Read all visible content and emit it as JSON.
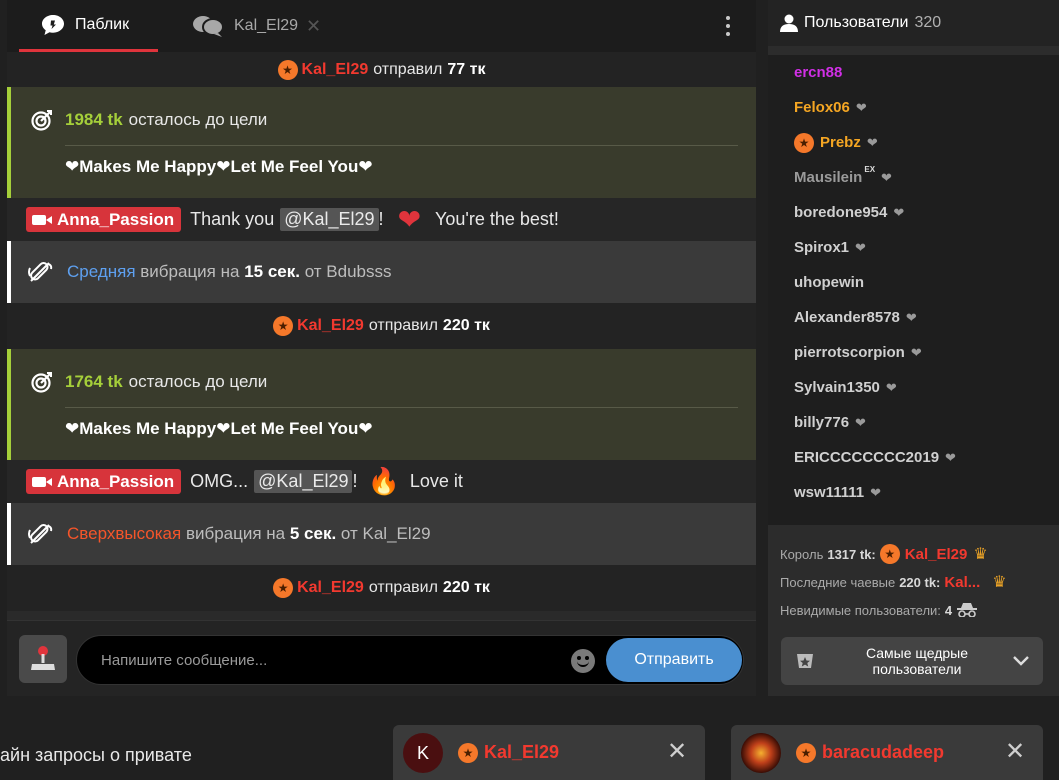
{
  "tabs": {
    "public_label": "Паблик",
    "private_label": "Kal_El29"
  },
  "feed": {
    "tip1": {
      "user": "Kal_El29",
      "text": "отправил",
      "amount": "77 тк"
    },
    "goal1": {
      "amount": "1984 tk",
      "text": "осталось до цели",
      "subject": "❤Makes Me Happy❤Let Me Feel You❤"
    },
    "msg1": {
      "user": "Anna_Passion",
      "pre": "Thank you",
      "mention": "@Kal_El29",
      "post": "!",
      "emoji": "❤",
      "tail": "You're the best!"
    },
    "vibe1": {
      "level": "Средняя",
      "mid": "вибрация на",
      "duration": "15 сек.",
      "from": "от Bdubsss"
    },
    "tip2": {
      "user": "Kal_El29",
      "text": "отправил",
      "amount": "220 тк"
    },
    "goal2": {
      "amount": "1764 tk",
      "text": "осталось до цели",
      "subject": "❤Makes Me Happy❤Let Me Feel You❤"
    },
    "msg2": {
      "user": "Anna_Passion",
      "pre": "OMG...",
      "mention": "@Kal_El29",
      "post": "!",
      "emoji": "🔥",
      "tail": "Love it"
    },
    "vibe2": {
      "level": "Сверхвысокая",
      "mid": "вибрация на",
      "duration": "5 сек.",
      "from": "от Kal_El29"
    },
    "tip3": {
      "user": "Kal_El29",
      "text": "отправил",
      "amount": "220 тк"
    }
  },
  "composer": {
    "placeholder": "Напишите сообщение...",
    "send_label": "Отправить"
  },
  "users": {
    "title": "Пользователи",
    "count": "320",
    "list": [
      {
        "name": "ercn88",
        "color": "#d12fe6",
        "heart": false
      },
      {
        "name": "Felox06",
        "color": "#f5a623",
        "heart": true
      },
      {
        "name": "Prebz",
        "color": "#f5a623",
        "heart": true,
        "star": true
      },
      {
        "name": "Mausilein",
        "color": "#9a9a9a",
        "heart": true,
        "ex": "EX"
      },
      {
        "name": "boredone954",
        "color": "#d0d0d0",
        "heart": true
      },
      {
        "name": "Spirox1",
        "color": "#d0d0d0",
        "heart": true
      },
      {
        "name": "uhopewin",
        "color": "#d0d0d0",
        "heart": false
      },
      {
        "name": "Alexander8578",
        "color": "#d0d0d0",
        "heart": true
      },
      {
        "name": "pierrotscorpion",
        "color": "#d0d0d0",
        "heart": true
      },
      {
        "name": "Sylvain1350",
        "color": "#d0d0d0",
        "heart": true
      },
      {
        "name": "billy776",
        "color": "#d0d0d0",
        "heart": true
      },
      {
        "name": "ERICCCCCCCC2019",
        "color": "#d0d0d0",
        "heart": true
      },
      {
        "name": "wsw11111",
        "color": "#d0d0d0",
        "heart": true
      }
    ],
    "king_label": "Король",
    "king_amount": "1317 tk:",
    "king_name": "Kal_El29",
    "last_label": "Последние чаевые",
    "last_amount": "220 tk:",
    "last_name": "Kal...",
    "invisible_label": "Невидимые пользователи:",
    "invisible_count": "4",
    "generous_label": "Самые щедрые пользователи"
  },
  "bottom": {
    "requests_text": "айн запросы о привате",
    "pm1_initial": "K",
    "pm1_name": "Kal_El29",
    "pm2_name": "baracudadeep"
  },
  "colors": {
    "accent_red": "#e0343c",
    "goal_green": "#a5cf3a",
    "send_blue": "#4a8fd0",
    "star_orange": "#f5782a"
  }
}
